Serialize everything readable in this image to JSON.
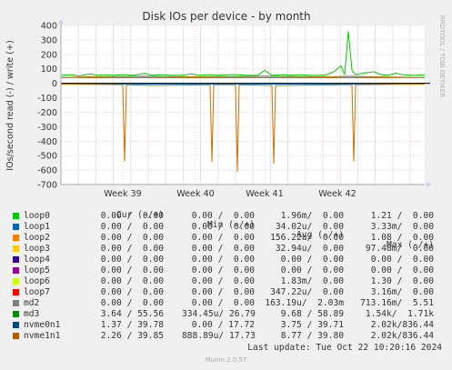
{
  "chart_data": {
    "type": "line",
    "title": "Disk IOs per device - by month",
    "ylabel": "IOs/second read (-) / write (+)",
    "side_label": "RRDTOOL / TOBI OETIKER",
    "ylim": [
      -700,
      400
    ],
    "yticks": [
      400,
      300,
      200,
      100,
      0,
      -100,
      -200,
      -300,
      -400,
      -500,
      -600,
      -700
    ],
    "xlim": [
      0,
      100
    ],
    "xticks": [
      {
        "label": "Week 39",
        "x": 17
      },
      {
        "label": "Week 40",
        "x": 37
      },
      {
        "label": "Week 41",
        "x": 56
      },
      {
        "label": "Week 42",
        "x": 76
      }
    ],
    "grid": true,
    "series": [
      {
        "name": "md3",
        "color": "#00cc00",
        "write": [
          [
            0,
            55
          ],
          [
            3,
            60
          ],
          [
            5,
            50
          ],
          [
            8,
            65
          ],
          [
            10,
            55
          ],
          [
            12,
            60
          ],
          [
            14,
            55
          ],
          [
            17,
            60
          ],
          [
            20,
            55
          ],
          [
            23,
            70
          ],
          [
            25,
            55
          ],
          [
            28,
            60
          ],
          [
            30,
            55
          ],
          [
            33,
            55
          ],
          [
            36,
            65
          ],
          [
            38,
            55
          ],
          [
            41,
            60
          ],
          [
            43,
            55
          ],
          [
            46,
            60
          ],
          [
            48,
            60
          ],
          [
            51,
            55
          ],
          [
            54,
            55
          ],
          [
            56,
            90
          ],
          [
            58,
            55
          ],
          [
            61,
            60
          ],
          [
            63,
            55
          ],
          [
            66,
            60
          ],
          [
            68,
            55
          ],
          [
            71,
            55
          ],
          [
            73,
            60
          ],
          [
            75,
            80
          ],
          [
            77,
            120
          ],
          [
            78,
            60
          ],
          [
            79,
            360
          ],
          [
            80,
            90
          ],
          [
            81,
            60
          ],
          [
            83,
            70
          ],
          [
            86,
            80
          ],
          [
            88,
            60
          ],
          [
            90,
            55
          ],
          [
            92,
            70
          ],
          [
            94,
            60
          ],
          [
            97,
            55
          ],
          [
            100,
            60
          ]
        ]
      },
      {
        "name": "nvme0n1",
        "color": "#0066b3",
        "write": [
          [
            0,
            40
          ],
          [
            100,
            40
          ]
        ],
        "read": [
          [
            0,
            -5
          ],
          [
            100,
            -5
          ]
        ]
      },
      {
        "name": "nvme1n1",
        "color": "#cc7000",
        "write": [
          [
            0,
            40
          ],
          [
            8,
            45
          ],
          [
            23,
            50
          ],
          [
            36,
            45
          ],
          [
            56,
            50
          ],
          [
            75,
            45
          ],
          [
            79,
            50
          ],
          [
            86,
            45
          ],
          [
            100,
            40
          ]
        ],
        "read": [
          [
            0,
            -5
          ],
          [
            17,
            -10
          ],
          [
            17.5,
            -540
          ],
          [
            18,
            -10
          ],
          [
            25,
            -15
          ],
          [
            41,
            -10
          ],
          [
            41.5,
            -545
          ],
          [
            42,
            -10
          ],
          [
            48,
            -10
          ],
          [
            48.5,
            -610
          ],
          [
            49,
            -10
          ],
          [
            58,
            -15
          ],
          [
            58.5,
            -555
          ],
          [
            59,
            -15
          ],
          [
            80,
            -10
          ],
          [
            80.5,
            -540
          ],
          [
            81,
            -10
          ],
          [
            100,
            -5
          ]
        ]
      }
    ]
  },
  "legend": {
    "headers": {
      "cur": "Cur (-/+)",
      "min": "Min (-/+)",
      "avg": "Avg (-/+)",
      "max": "Max (-/+)"
    },
    "rows": [
      {
        "name": "loop0",
        "color": "#00cc00",
        "cur": "0.00 /  0.00",
        "min": "0.00 /  0.00",
        "avg": "1.96m/  0.00",
        "max": "1.21 /  0.00"
      },
      {
        "name": "loop1",
        "color": "#0066b3",
        "cur": "0.00 /  0.00",
        "min": "0.00 /  0.00",
        "avg": "34.02u/  0.00",
        "max": "3.33m/  0.00"
      },
      {
        "name": "loop2",
        "color": "#ff8000",
        "cur": "0.00 /  0.00",
        "min": "0.00 /  0.00",
        "avg": "156.22u/  0.00",
        "max": "1.08 /  0.00"
      },
      {
        "name": "loop3",
        "color": "#ffcc00",
        "cur": "0.00 /  0.00",
        "min": "0.00 /  0.00",
        "avg": "32.94u/  0.00",
        "max": "97.48m/  0.00"
      },
      {
        "name": "loop4",
        "color": "#330099",
        "cur": "0.00 /  0.00",
        "min": "0.00 /  0.00",
        "avg": "0.00 /  0.00",
        "max": "0.00 /  0.00"
      },
      {
        "name": "loop5",
        "color": "#990099",
        "cur": "0.00 /  0.00",
        "min": "0.00 /  0.00",
        "avg": "0.00 /  0.00",
        "max": "0.00 /  0.00"
      },
      {
        "name": "loop6",
        "color": "#ccff00",
        "cur": "0.00 /  0.00",
        "min": "0.00 /  0.00",
        "avg": "1.83m/  0.00",
        "max": "1.30 /  0.00"
      },
      {
        "name": "loop7",
        "color": "#ff0000",
        "cur": "0.00 /  0.00",
        "min": "0.00 /  0.00",
        "avg": "347.22u/  0.00",
        "max": "3.16m/  0.00"
      },
      {
        "name": "md2",
        "color": "#808080",
        "cur": "0.00 /  0.00",
        "min": "0.00 /  0.00",
        "avg": "163.19u/  2.03m",
        "max": "713.16m/  5.51"
      },
      {
        "name": "md3",
        "color": "#008f00",
        "cur": "3.64 / 55.56",
        "min": "334.45u/ 26.79",
        "avg": "9.68 / 58.89",
        "max": "1.54k/  1.71k"
      },
      {
        "name": "nvme0n1",
        "color": "#00487d",
        "cur": "1.37 / 39.78",
        "min": "0.00 / 17.72",
        "avg": "3.75 / 39.71",
        "max": "2.02k/836.44"
      },
      {
        "name": "nvme1n1",
        "color": "#b35a00",
        "cur": "2.26 / 39.85",
        "min": "888.89u/ 17.73",
        "avg": "8.77 / 39.80",
        "max": "2.02k/836.44"
      }
    ]
  },
  "last_update": "Last update: Tue Oct 22 10:20:16 2024",
  "munin_version": "Munin 2.0.57"
}
